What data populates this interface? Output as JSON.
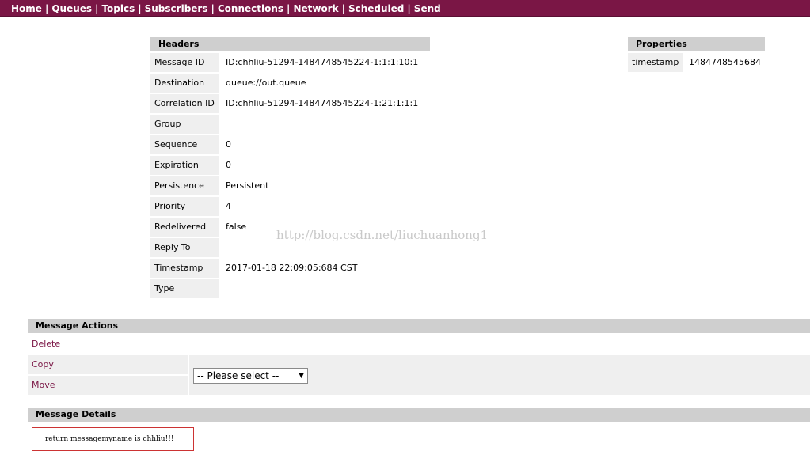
{
  "nav": {
    "items": [
      "Home",
      "Queues",
      "Topics",
      "Subscribers",
      "Connections",
      "Network",
      "Scheduled",
      "Send"
    ]
  },
  "headers": {
    "title": "Headers",
    "rows": [
      {
        "key": "Message ID",
        "value": "ID:chhliu-51294-1484748545224-1:1:1:10:1"
      },
      {
        "key": "Destination",
        "value": "queue://out.queue"
      },
      {
        "key": "Correlation ID",
        "value": "ID:chhliu-51294-1484748545224-1:21:1:1:1"
      },
      {
        "key": "Group",
        "value": ""
      },
      {
        "key": "Sequence",
        "value": "0"
      },
      {
        "key": "Expiration",
        "value": "0"
      },
      {
        "key": "Persistence",
        "value": "Persistent"
      },
      {
        "key": "Priority",
        "value": "4"
      },
      {
        "key": "Redelivered",
        "value": "false"
      },
      {
        "key": "Reply To",
        "value": ""
      },
      {
        "key": "Timestamp",
        "value": "2017-01-18 22:09:05:684 CST"
      },
      {
        "key": "Type",
        "value": ""
      }
    ]
  },
  "properties": {
    "title": "Properties",
    "key": "timestamp",
    "value": "1484748545684"
  },
  "watermark": "http://blog.csdn.net/liuchuanhong1",
  "actions": {
    "title": "Message Actions",
    "delete": "Delete",
    "copy": "Copy",
    "move": "Move",
    "select_value": "-- Please select --"
  },
  "details": {
    "title": "Message Details",
    "body": "return messagemyname is chhliu!!!"
  },
  "colors": {
    "nav_bg": "#7a1645",
    "link": "#7a1645",
    "header_bg": "#cfcfcf",
    "row_bg": "#efefef"
  }
}
